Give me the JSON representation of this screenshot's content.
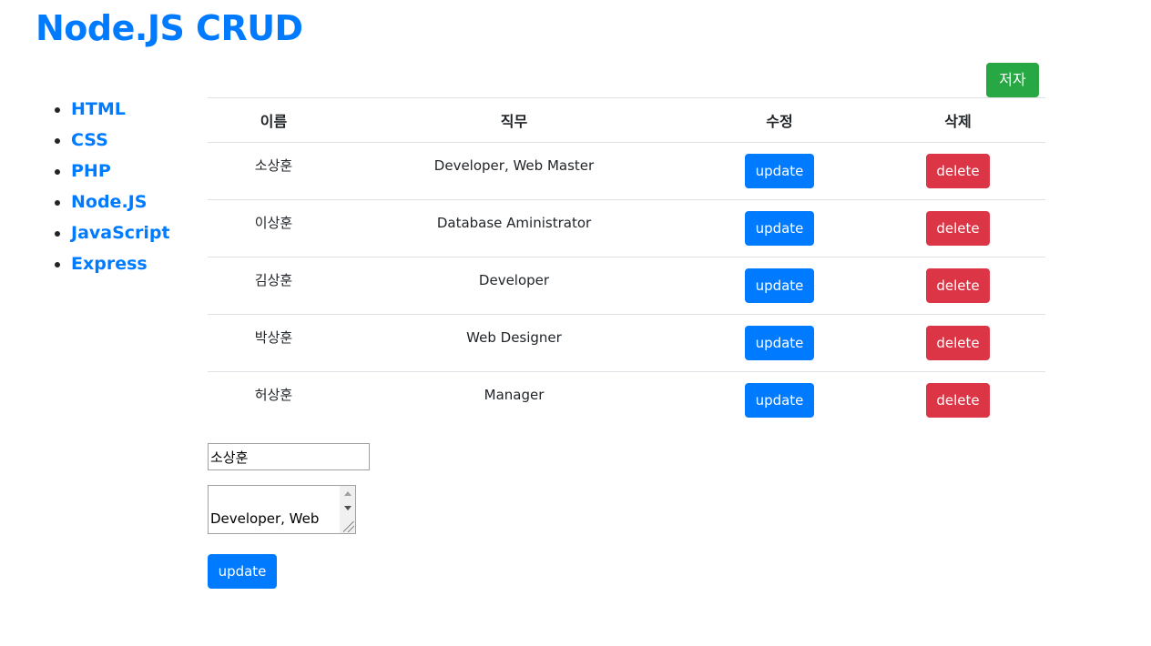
{
  "header": {
    "title": "Node.JS CRUD"
  },
  "sidebar": {
    "items": [
      {
        "label": "HTML"
      },
      {
        "label": "CSS"
      },
      {
        "label": "PHP"
      },
      {
        "label": "Node.JS"
      },
      {
        "label": "JavaScript"
      },
      {
        "label": "Express"
      }
    ]
  },
  "toolbar": {
    "author_label": "저자"
  },
  "table": {
    "headers": [
      "이름",
      "직무",
      "수정",
      "삭제"
    ],
    "rows": [
      {
        "name": "소상훈",
        "job": "Developer, Web Master",
        "update_label": "update",
        "delete_label": "delete"
      },
      {
        "name": "이상훈",
        "job": "Database Aministrator",
        "update_label": "update",
        "delete_label": "delete"
      },
      {
        "name": "김상훈",
        "job": "Developer",
        "update_label": "update",
        "delete_label": "delete"
      },
      {
        "name": "박상훈",
        "job": "Web Designer",
        "update_label": "update",
        "delete_label": "delete"
      },
      {
        "name": "허상훈",
        "job": "Manager",
        "update_label": "update",
        "delete_label": "delete"
      }
    ]
  },
  "form": {
    "name_value": "소상훈",
    "job_value": "Developer, Web",
    "submit_label": "update"
  },
  "colors": {
    "primary": "#007bff",
    "success": "#28a745",
    "danger": "#dc3545"
  }
}
